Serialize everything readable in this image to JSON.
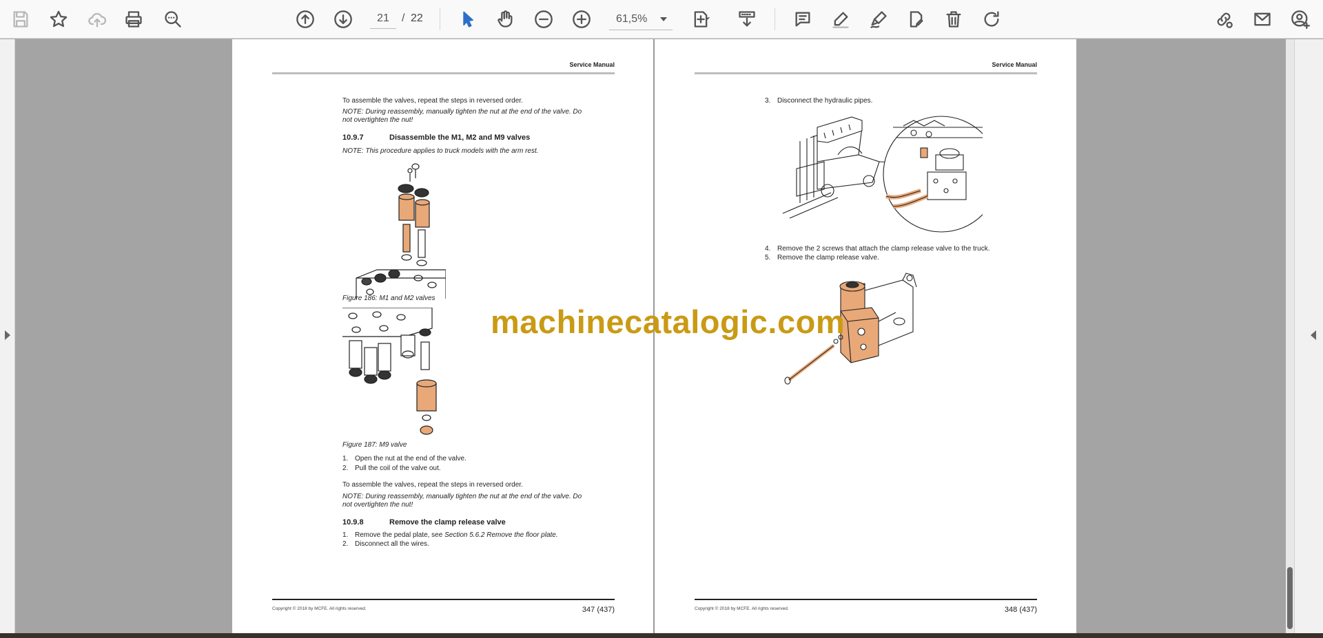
{
  "toolbar": {
    "page_current": "21",
    "page_separator": "/",
    "page_total": "22",
    "zoom": "61,5%"
  },
  "pages": {
    "left": {
      "header": "Service Manual",
      "p1": "To assemble the valves, repeat the steps in reversed order.",
      "note1": "NOTE: During reassembly, manually tighten the nut at the end of the valve. Do not overtighten the nut!",
      "sec1_num": "10.9.7",
      "sec1_title": "Disassemble the M1, M2 and M9 valves",
      "note2": "NOTE: This procedure applies to truck models with the arm rest.",
      "fig186": "Figure 186: M1 and M2 valves",
      "fig187": "Figure 187: M9 valve",
      "steps1": [
        {
          "n": "1.",
          "text": "Open the nut at the end of the valve."
        },
        {
          "n": "2.",
          "text": "Pull the coil of the valve out."
        }
      ],
      "p2": "To assemble the valves, repeat the steps in reversed order.",
      "note3": "NOTE: During reassembly, manually tighten the nut at the end of the valve. Do not overtighten the nut!",
      "sec2_num": "10.9.8",
      "sec2_title": "Remove the clamp release valve",
      "steps2": [
        {
          "n": "1.",
          "text": "Remove the pedal plate, see ",
          "ref": "Section 5.6.2 Remove the floor plate."
        },
        {
          "n": "2.",
          "text": "Disconnect all the wires."
        }
      ],
      "footer_copy": "Copyright © 2018 by MCFE. All rights reserved.",
      "footer_page": "347 (437)"
    },
    "right": {
      "header": "Service Manual",
      "step3": {
        "n": "3.",
        "text": "Disconnect the hydraulic pipes."
      },
      "step4": {
        "n": "4.",
        "text": "Remove the 2 screws that attach the clamp release valve to the truck."
      },
      "step5": {
        "n": "5.",
        "text": "Remove the clamp release valve."
      },
      "footer_copy": "Copyright © 2018 by MCFE. All rights reserved.",
      "footer_page": "348 (437)"
    }
  },
  "watermark": "machinecatalogic.com",
  "colors": {
    "accent": "#2c6fc9",
    "watermark": "#c99a14",
    "part_orange": "#e8a878",
    "viewer_bg": "#a4a4a4"
  }
}
